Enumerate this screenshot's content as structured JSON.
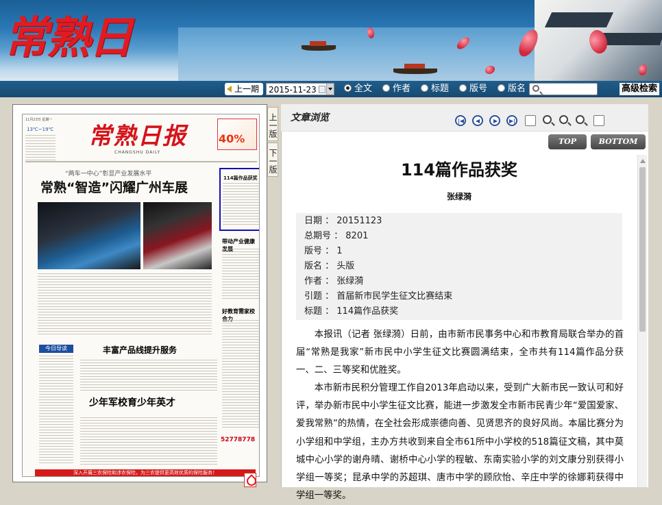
{
  "header": {
    "logo_text": "常熟日报"
  },
  "toolbar": {
    "prev_issue_label": "上一期",
    "date_value": "2015-11-23",
    "search_modes": [
      {
        "label": "全文",
        "selected": true
      },
      {
        "label": "作者",
        "selected": false
      },
      {
        "label": "标题",
        "selected": false
      },
      {
        "label": "版号",
        "selected": false
      },
      {
        "label": "版名",
        "selected": false
      }
    ],
    "search_placeholder": "",
    "advanced_search_label": "高级检索"
  },
  "page_thumb": {
    "date_line": "11月23日 星期一",
    "weather": "13℃~19℃",
    "masthead": "常熟日报",
    "masthead_sub": "CHANGSHU DAILY",
    "ad_number": "40%",
    "kicker": "“两车一中心”彰显产业发展水平",
    "headline": "常熟“智造”闪耀广州车展",
    "selected_article_title": "114篇作品获奖",
    "side_story_1": "带动产业健康发展",
    "side_story_2": "好教育需家校合力",
    "subhead_1": "丰富产品线提升服务",
    "subhead_2": "少年军校育少年英才",
    "today_box": "今日导读",
    "phone_number": "52778778",
    "footer_banner": "深入开展三农保险和涉农保险，为三农提供更高效优质的保险服务！"
  },
  "side_nav": {
    "prev_page_label": "上一版",
    "next_page_label": "下一版"
  },
  "preview": {
    "title": "文章浏览",
    "top_label": "TOP",
    "bottom_label": "BOTTOM"
  },
  "article": {
    "title": "114篇作品获奖",
    "author": "张绿漪",
    "meta": {
      "date_label": "日期",
      "date_value": "20151123",
      "issue_label": "总期号",
      "issue_value": "8201",
      "page_label": "版号",
      "page_value": "1",
      "pagename_label": "版名",
      "pagename_value": "头版",
      "author_label": "作者",
      "author_value": "张绿漪",
      "lead_label": "引题",
      "lead_value": "首届新市民学生征文比赛结束",
      "title_label": "标题",
      "title_value": "114篇作品获奖"
    },
    "paragraphs": [
      "本报讯（记者 张绿漪）日前，由市新市民事务中心和市教育局联合举办的首届“常熟是我家”新市民中小学生征文比赛圆满结束，全市共有114篇作品分获一、二、三等奖和优胜奖。",
      "本市新市民积分管理工作自2013年启动以来，受到广大新市民一致认可和好评，举办新市民中小学生征文比赛，能进一步激发全市新市民青少年“爱国爱家、爱我常熟”的热情，在全社会形成崇德向善、见贤思齐的良好风尚。本届比赛分为小学组和中学组，主办方共收到来自全市61所中小学校的518篇征文稿，其中莫城中心小学的谢舟晴、谢桥中心小学的程敏、东南实验小学的刘文康分别获得小学组一等奖；昆承中学的苏超琪、唐市中学的顾欣怡、辛庄中学的徐娜莉获得中学组一等奖。"
    ]
  }
}
